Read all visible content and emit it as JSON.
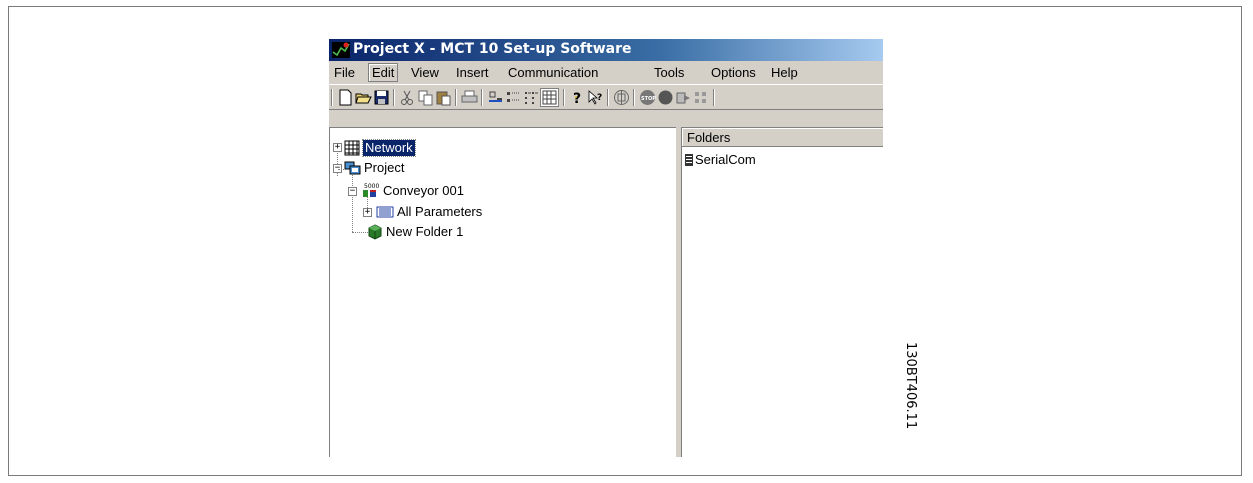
{
  "window": {
    "title": "Project X - MCT 10 Set-up Software"
  },
  "menu": {
    "items": [
      {
        "label": "File",
        "name": "menu-file"
      },
      {
        "label": "Edit",
        "name": "menu-edit"
      },
      {
        "label": "View",
        "name": "menu-view"
      },
      {
        "label": "Insert",
        "name": "menu-insert"
      },
      {
        "label": "Communication",
        "name": "menu-communication"
      },
      {
        "label": "Tools",
        "name": "menu-tools"
      },
      {
        "label": "Options",
        "name": "menu-options"
      },
      {
        "label": "Help",
        "name": "menu-help"
      }
    ],
    "active": "Edit"
  },
  "toolbar": {
    "buttons": [
      "new-icon",
      "open-icon",
      "save-icon",
      "cut-icon",
      "copy-icon",
      "paste-icon",
      "print-icon",
      "large-icons-icon",
      "small-icons-icon",
      "list-view-icon",
      "details-view-icon",
      "help-icon",
      "context-help-icon",
      "network-scan-icon",
      "stop-icon",
      "record-icon",
      "read-from-drive-icon",
      "write-to-drive-icon"
    ]
  },
  "tree": {
    "network": "Network",
    "project": "Project",
    "conveyor": "Conveyor 001",
    "all_parameters": "All Parameters",
    "new_folder": "New Folder 1"
  },
  "list": {
    "header": "Folders",
    "items": [
      "SerialCom"
    ]
  },
  "document_code": "130BT406.11",
  "colors": {
    "titlebar_start": "#0a246a",
    "titlebar_end": "#a6caf0",
    "window_bg": "#d4d0c8",
    "selection": "#0a246a"
  }
}
